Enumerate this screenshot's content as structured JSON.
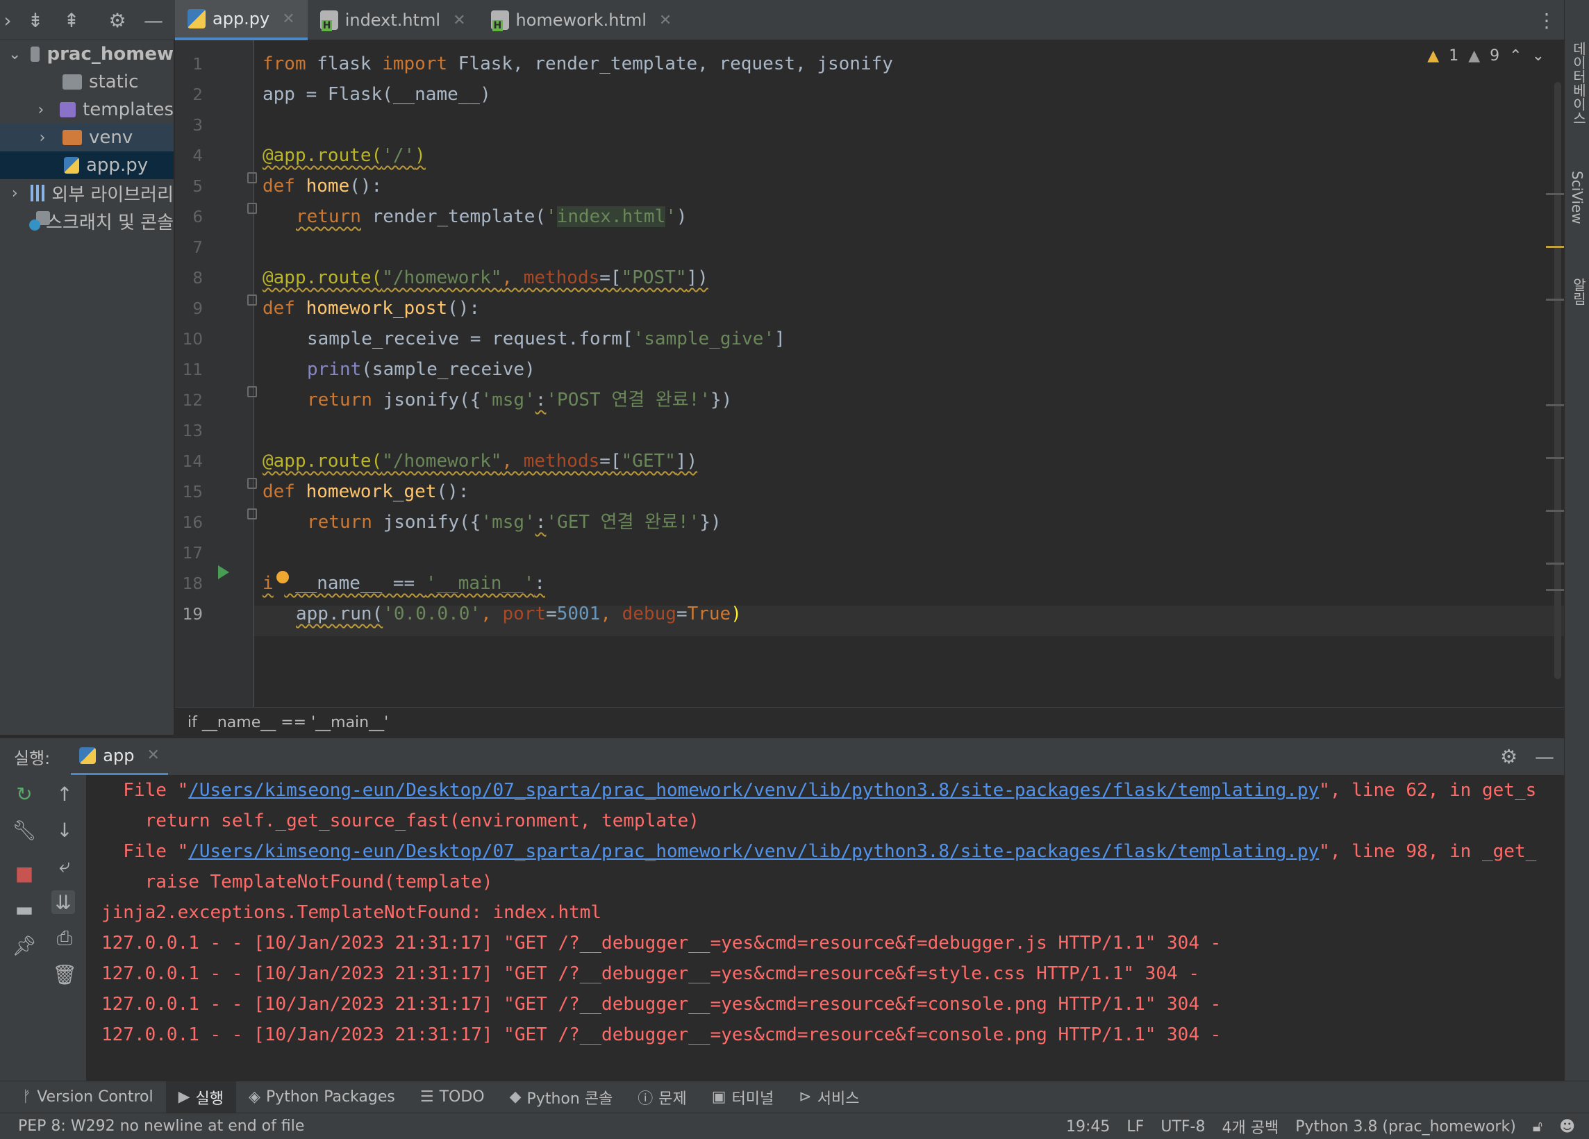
{
  "editor_tabs": [
    {
      "label": "app.py",
      "type": "python",
      "active": true
    },
    {
      "label": "indext.html",
      "type": "html",
      "active": false
    },
    {
      "label": "homework.html",
      "type": "html",
      "active": false
    }
  ],
  "project_tree": [
    {
      "label": "prac_homew",
      "kind": "folder-gray",
      "expanded": true
    },
    {
      "label": "static",
      "kind": "folder-gray"
    },
    {
      "label": "templates",
      "kind": "folder-purple"
    },
    {
      "label": "venv",
      "kind": "folder-orange"
    },
    {
      "label": "app.py",
      "kind": "python-file"
    },
    {
      "label": "외부 라이브러리",
      "kind": "library"
    },
    {
      "label": "스크래치 및 콘솔",
      "kind": "scratch"
    }
  ],
  "right_strip": [
    "데이터베이스",
    "SciView",
    "알림"
  ],
  "inspections": {
    "warnings": "1",
    "weak_warnings": "9"
  },
  "line_numbers": [
    "1",
    "2",
    "3",
    "4",
    "5",
    "6",
    "7",
    "8",
    "9",
    "10",
    "11",
    "12",
    "13",
    "14",
    "15",
    "16",
    "17",
    "18",
    "19"
  ],
  "code": {
    "l1": {
      "kw1": "from",
      "mod": " flask ",
      "kw2": "import",
      "rest": " Flask, render_template, request, jsonify"
    },
    "l2": "app = Flask(__name__)",
    "l4": {
      "dec": "@app.route(",
      "str": "'/'",
      "close": ")"
    },
    "l5": {
      "kw": "def",
      "fn": "home",
      "rest": "():"
    },
    "l6": {
      "kw": "return",
      "call": " render_template(",
      "q1": "'",
      "hl": "index.html",
      "q2": "'",
      "close": ")"
    },
    "l8": {
      "dec": "@app.route(",
      "str": "\"/homework\"",
      "comma": ", ",
      "param": "methods",
      "eq": "=[",
      "str2": "\"POST\"",
      "close": "])"
    },
    "l9": {
      "kw": "def",
      "fn": "homework_post",
      "rest": "():"
    },
    "l10": {
      "pre": "sample_receive = request.form[",
      "str": "'sample_give'",
      "close": "]"
    },
    "l11": {
      "builtin": "print",
      "rest": "(sample_receive)"
    },
    "l12": {
      "kw": "return",
      "call": " jsonify({",
      "s1": "'msg'",
      "colon": ":",
      "s2": "'POST 연결 완료!'",
      "close": "})"
    },
    "l14": {
      "dec": "@app.route(",
      "str": "\"/homework\"",
      "comma": ", ",
      "param": "methods",
      "eq": "=[",
      "str2": "\"GET\"",
      "close": "])"
    },
    "l15": {
      "kw": "def",
      "fn": "homework_get",
      "rest": "():"
    },
    "l16": {
      "kw": "return",
      "call": " jsonify({",
      "s1": "'msg'",
      "colon": ":",
      "s2": "'GET 연결 완료!'",
      "close": "})"
    },
    "l18": {
      "kw": "i",
      "kw2": "f",
      "mid": " __name__ == ",
      "str": "'__main__'",
      "colon": ":"
    },
    "l19": {
      "pre": "app.run(",
      "str": "'0.0.0.0'",
      "comma": ", ",
      "p1": "port",
      "eq1": "=",
      "n1": "5001",
      "comma2": ", ",
      "p2": "debug",
      "eq2": "=",
      "kw": "True",
      "close": ")"
    }
  },
  "breadcrumb": "if __name__ == '__main__'",
  "run_panel": {
    "title": "실행:",
    "tab": "app"
  },
  "console": {
    "file_prefix": "  File \"",
    "l1_path": "/Users/kimseong-eun/Desktop/07_sparta/prac_homework/venv/lib/python3.8/site-packages/flask/templating.py",
    "l1_suffix": "\", line 62, in get_s",
    "l2": "    return self._get_source_fast(environment, template)",
    "l3_path": "/Users/kimseong-eun/Desktop/07_sparta/prac_homework/venv/lib/python3.8/site-packages/flask/templating.py",
    "l3_suffix": "\", line 98, in _get_",
    "l4": "    raise TemplateNotFound(template)",
    "l5": "jinja2.exceptions.TemplateNotFound: index.html",
    "l6": "127.0.0.1 - - [10/Jan/2023 21:31:17] \"GET /?__debugger__=yes&cmd=resource&f=debugger.js HTTP/1.1\" 304 -",
    "l7": "127.0.0.1 - - [10/Jan/2023 21:31:17] \"GET /?__debugger__=yes&cmd=resource&f=style.css HTTP/1.1\" 304 -",
    "l8": "127.0.0.1 - - [10/Jan/2023 21:31:17] \"GET /?__debugger__=yes&cmd=resource&f=console.png HTTP/1.1\" 304 -",
    "l9": "127.0.0.1 - - [10/Jan/2023 21:31:17] \"GET /?__debugger__=yes&cmd=resource&f=console.png HTTP/1.1\" 304 -"
  },
  "tool_windows": [
    "Version Control",
    "실행",
    "Python Packages",
    "TODO",
    "Python 콘솔",
    "문제",
    "터미널",
    "서비스"
  ],
  "status": {
    "message": "PEP 8: W292 no newline at end of file",
    "position": "19:45",
    "line_sep": "LF",
    "encoding": "UTF-8",
    "indent": "4개 공백",
    "interpreter": "Python 3.8 (prac_homework)"
  },
  "colors": {
    "accent": "#4a88c7",
    "error_text": "#ff6b68",
    "link": "#5394ec",
    "keyword": "#cc7832",
    "function": "#ffc66d",
    "string": "#6a8759"
  }
}
